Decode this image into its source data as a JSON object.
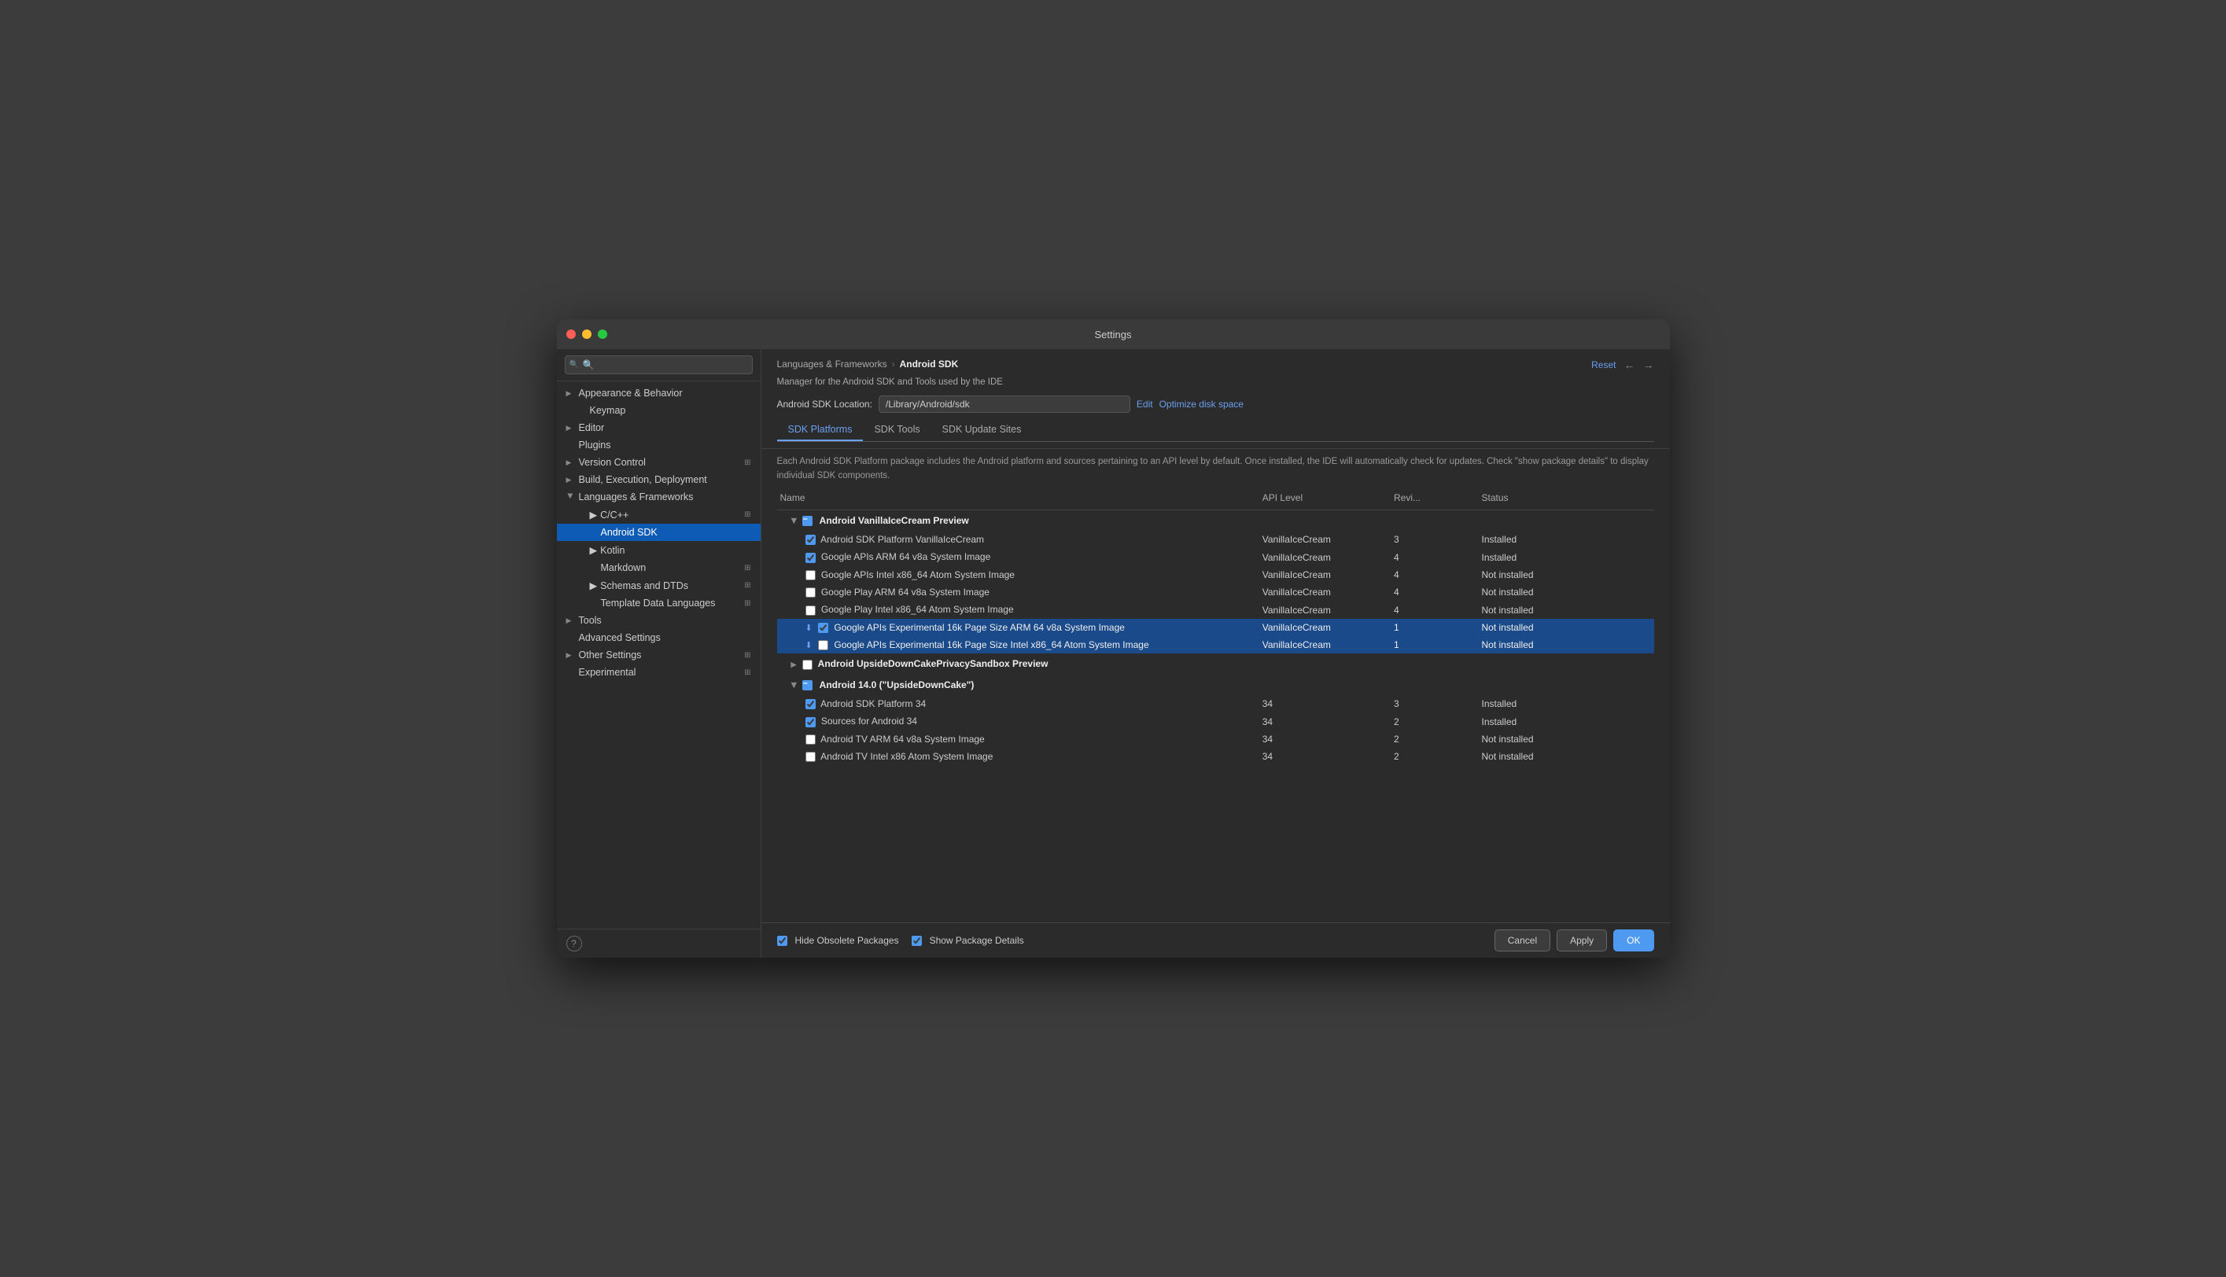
{
  "window": {
    "title": "Settings"
  },
  "sidebar": {
    "search_placeholder": "🔍",
    "items": [
      {
        "id": "appearance",
        "label": "Appearance & Behavior",
        "indent": 0,
        "has_arrow": true,
        "arrow_down": false,
        "has_icon": false
      },
      {
        "id": "keymap",
        "label": "Keymap",
        "indent": 1,
        "has_arrow": false,
        "has_icon": false
      },
      {
        "id": "editor",
        "label": "Editor",
        "indent": 0,
        "has_arrow": true,
        "arrow_down": false,
        "has_icon": false
      },
      {
        "id": "plugins",
        "label": "Plugins",
        "indent": 0,
        "has_arrow": false,
        "has_icon": false
      },
      {
        "id": "version-control",
        "label": "Version Control",
        "indent": 0,
        "has_arrow": true,
        "arrow_down": false,
        "has_icon": true
      },
      {
        "id": "build",
        "label": "Build, Execution, Deployment",
        "indent": 0,
        "has_arrow": true,
        "arrow_down": false,
        "has_icon": false
      },
      {
        "id": "languages",
        "label": "Languages & Frameworks",
        "indent": 0,
        "has_arrow": true,
        "arrow_down": true,
        "has_icon": false
      },
      {
        "id": "cpp",
        "label": "C/C++",
        "indent": 1,
        "has_arrow": true,
        "arrow_down": false,
        "has_icon": true
      },
      {
        "id": "android-sdk",
        "label": "Android SDK",
        "indent": 2,
        "has_arrow": false,
        "has_icon": false,
        "active": true
      },
      {
        "id": "kotlin",
        "label": "Kotlin",
        "indent": 1,
        "has_arrow": true,
        "arrow_down": false,
        "has_icon": false
      },
      {
        "id": "markdown",
        "label": "Markdown",
        "indent": 1,
        "has_arrow": false,
        "has_icon": true
      },
      {
        "id": "schemas",
        "label": "Schemas and DTDs",
        "indent": 1,
        "has_arrow": true,
        "arrow_down": false,
        "has_icon": true
      },
      {
        "id": "template-data",
        "label": "Template Data Languages",
        "indent": 1,
        "has_arrow": false,
        "has_icon": true
      },
      {
        "id": "tools",
        "label": "Tools",
        "indent": 0,
        "has_arrow": true,
        "arrow_down": false,
        "has_icon": false
      },
      {
        "id": "advanced",
        "label": "Advanced Settings",
        "indent": 0,
        "has_arrow": false,
        "has_icon": false
      },
      {
        "id": "other",
        "label": "Other Settings",
        "indent": 0,
        "has_arrow": true,
        "arrow_down": false,
        "has_icon": true
      },
      {
        "id": "experimental",
        "label": "Experimental",
        "indent": 0,
        "has_arrow": false,
        "has_icon": true
      }
    ]
  },
  "breadcrumb": {
    "parent": "Languages & Frameworks",
    "separator": "›",
    "current": "Android SDK"
  },
  "panel": {
    "description": "Manager for the Android SDK and Tools used by the IDE",
    "sdk_location_label": "Android SDK Location:",
    "sdk_location_value": "/Library/Android/sdk",
    "edit_label": "Edit",
    "optimize_label": "Optimize disk space",
    "reset_label": "Reset",
    "tabs": [
      {
        "id": "sdk-platforms",
        "label": "SDK Platforms",
        "active": true
      },
      {
        "id": "sdk-tools",
        "label": "SDK Tools",
        "active": false
      },
      {
        "id": "sdk-update-sites",
        "label": "SDK Update Sites",
        "active": false
      }
    ],
    "table_description": "Each Android SDK Platform package includes the Android platform and sources pertaining to an API level by default. Once installed, the IDE will automatically check for updates. Check \"show package details\" to display individual SDK components.",
    "columns": {
      "name": "Name",
      "api_level": "API Level",
      "revision": "Revi...",
      "status": "Status"
    }
  },
  "table_rows": [
    {
      "type": "group",
      "expanded": true,
      "checkbox": "partial",
      "name": "Android VanillaIceCream Preview",
      "api": "",
      "rev": "",
      "status": "",
      "indent": 0,
      "highlighted": false
    },
    {
      "type": "item",
      "checked": true,
      "name": "Android SDK Platform VanillaIceCream",
      "api": "VanillaIceCream",
      "rev": "3",
      "status": "Installed",
      "indent": 1,
      "highlighted": false
    },
    {
      "type": "item",
      "checked": true,
      "name": "Google APIs ARM 64 v8a System Image",
      "api": "VanillaIceCream",
      "rev": "4",
      "status": "Installed",
      "indent": 1,
      "highlighted": false
    },
    {
      "type": "item",
      "checked": false,
      "name": "Google APIs Intel x86_64 Atom System Image",
      "api": "VanillaIceCream",
      "rev": "4",
      "status": "Not installed",
      "indent": 1,
      "highlighted": false
    },
    {
      "type": "item",
      "checked": false,
      "name": "Google Play ARM 64 v8a System Image",
      "api": "VanillaIceCream",
      "rev": "4",
      "status": "Not installed",
      "indent": 1,
      "highlighted": false
    },
    {
      "type": "item",
      "checked": false,
      "name": "Google Play Intel x86_64 Atom System Image",
      "api": "VanillaIceCream",
      "rev": "4",
      "status": "Not installed",
      "indent": 1,
      "highlighted": false
    },
    {
      "type": "item",
      "checked": true,
      "download": true,
      "name": "Google APIs Experimental 16k Page Size ARM 64 v8a System Image",
      "api": "VanillaIceCream",
      "rev": "1",
      "status": "Not installed",
      "indent": 1,
      "highlighted": true
    },
    {
      "type": "item",
      "checked": false,
      "download": true,
      "name": "Google APIs Experimental 16k Page Size Intel x86_64 Atom System Image",
      "api": "VanillaIceCream",
      "rev": "1",
      "status": "Not installed",
      "indent": 1,
      "highlighted": true
    },
    {
      "type": "group",
      "expanded": false,
      "checkbox": "empty",
      "name": "Android UpsideDownCakePrivacySandbox Preview",
      "api": "",
      "rev": "",
      "status": "",
      "indent": 0,
      "highlighted": false
    },
    {
      "type": "group",
      "expanded": true,
      "checkbox": "partial",
      "name": "Android 14.0 (\"UpsideDownCake\")",
      "api": "",
      "rev": "",
      "status": "",
      "indent": 0,
      "highlighted": false
    },
    {
      "type": "item",
      "checked": true,
      "name": "Android SDK Platform 34",
      "api": "34",
      "rev": "3",
      "status": "Installed",
      "indent": 1,
      "highlighted": false
    },
    {
      "type": "item",
      "checked": true,
      "name": "Sources for Android 34",
      "api": "34",
      "rev": "2",
      "status": "Installed",
      "indent": 1,
      "highlighted": false
    },
    {
      "type": "item",
      "checked": false,
      "name": "Android TV ARM 64 v8a System Image",
      "api": "34",
      "rev": "2",
      "status": "Not installed",
      "indent": 1,
      "highlighted": false
    },
    {
      "type": "item",
      "checked": false,
      "name": "Android TV Intel x86 Atom System Image",
      "api": "34",
      "rev": "2",
      "status": "Not installed",
      "indent": 1,
      "highlighted": false
    }
  ],
  "footer": {
    "hide_obsolete_label": "Hide Obsolete Packages",
    "show_package_label": "Show Package Details",
    "hide_obsolete_checked": true,
    "show_package_checked": true
  },
  "buttons": {
    "cancel": "Cancel",
    "apply": "Apply",
    "ok": "OK"
  }
}
